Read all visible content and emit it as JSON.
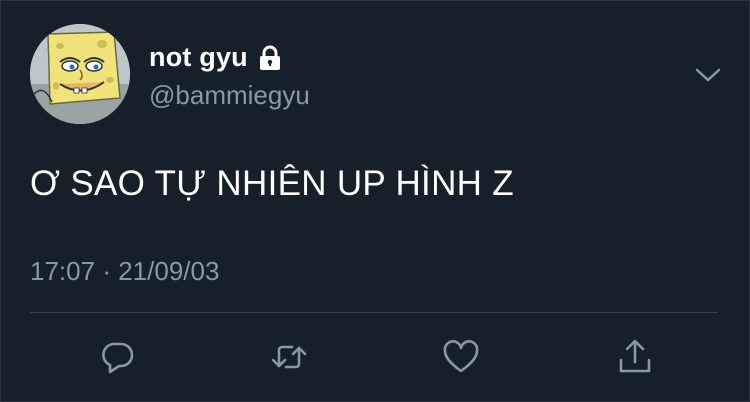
{
  "tweet": {
    "author": {
      "display_name": "not gyu",
      "handle": "@bammiegyu",
      "protected_icon": "lock-icon",
      "avatar": "spongebob-avatar"
    },
    "text": "Ơ SAO TỰ NHIÊN UP HÌNH Z",
    "time": "17:07",
    "separator": "·",
    "date": "21/09/03"
  },
  "actions": [
    {
      "name": "reply",
      "icon": "reply-icon"
    },
    {
      "name": "retweet",
      "icon": "retweet-icon"
    },
    {
      "name": "like",
      "icon": "heart-icon"
    },
    {
      "name": "share",
      "icon": "share-icon"
    }
  ],
  "menu_icon": "chevron-down-icon",
  "colors": {
    "background": "#15202b",
    "primary_text": "#ffffff",
    "secondary_text": "#8899a6",
    "divider": "#38444d"
  }
}
